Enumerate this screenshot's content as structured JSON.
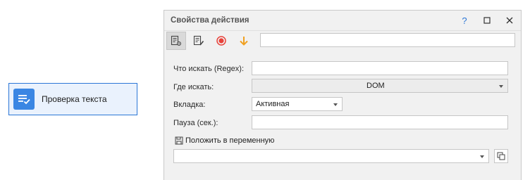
{
  "canvas": {
    "action": {
      "label": "Проверка текста",
      "icon": "text-check-icon"
    }
  },
  "panel": {
    "title": "Свойства действия",
    "controls": {
      "help": "?",
      "help_icon": "help-icon",
      "maximize_icon": "maximize-icon",
      "close_icon": "close-icon"
    },
    "toolbar": {
      "tools": [
        "action-settings-icon",
        "edit-notes-icon",
        "record-icon",
        "arrow-down-icon"
      ],
      "input_value": ""
    },
    "fields": {
      "search_label": "Что искать (Regex):",
      "search_value": "",
      "where_label": "Где искать:",
      "where_value": "DOM",
      "tab_label": "Вкладка:",
      "tab_value": "Активная",
      "pause_label": "Пауза (сек.):",
      "pause_value": ""
    },
    "save": {
      "label": "Положить в переменную",
      "icon": "floppy-disk-icon",
      "value": ""
    }
  },
  "colors": {
    "accent": "#2b76d6",
    "action_bg": "#eaf2fd",
    "record": "#e8433b",
    "arrow": "#f0a020",
    "panel_bg": "#f1f1f1"
  }
}
